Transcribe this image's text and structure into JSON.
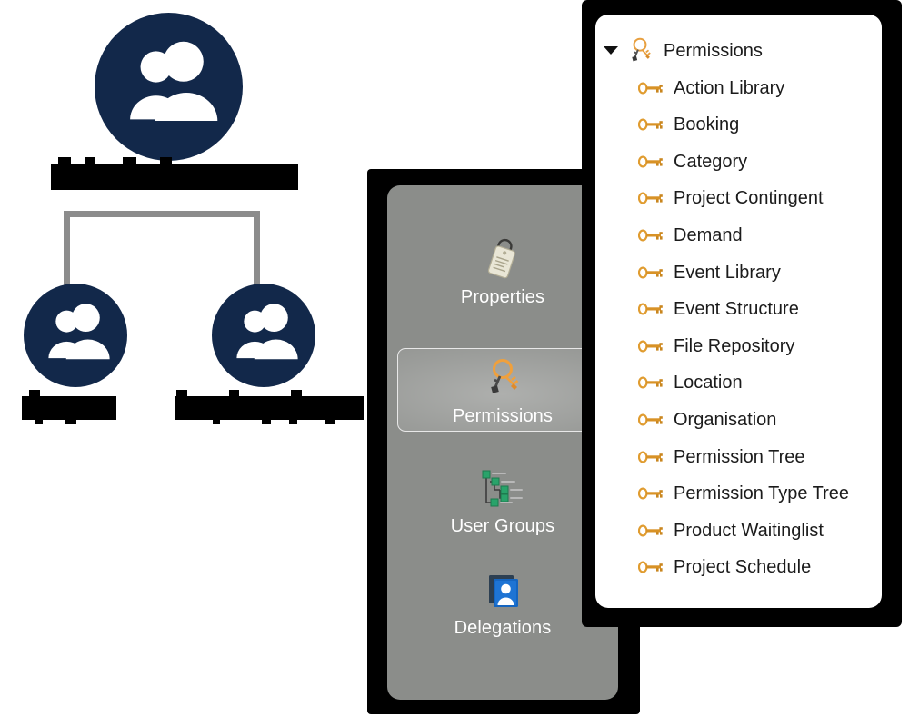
{
  "org_diagram": {
    "name": "organisation-hierarchy-diagram",
    "nodes": [
      {
        "id": "root",
        "icon": "users-group-icon",
        "label_redacted": true,
        "label": ""
      },
      {
        "id": "left",
        "icon": "users-group-icon",
        "label_redacted": true,
        "label": ""
      },
      {
        "id": "right",
        "icon": "users-group-icon",
        "label_redacted": true,
        "label": ""
      }
    ],
    "node_color": "#12284a",
    "connector_color": "#8c8c8c",
    "redaction_color": "#000000"
  },
  "sidebar": {
    "name": "module-navigation-sidebar",
    "background": "#8b8d8a",
    "selected": "Permissions",
    "items": [
      {
        "label": "Properties",
        "icon": "luggage-tag-icon",
        "selected": false
      },
      {
        "label": "Permissions",
        "icon": "keyring-keys-icon",
        "selected": true
      },
      {
        "label": "User Groups",
        "icon": "tree-nodes-icon",
        "selected": false
      },
      {
        "label": "Delegations",
        "icon": "person-card-icon",
        "selected": false
      }
    ]
  },
  "tree_panel": {
    "name": "permissions-tree-panel",
    "background": "#ffffff",
    "root": {
      "label": "Permissions",
      "icon": "keyring-keys-icon",
      "expanded": true,
      "twisty": "triangle-down-icon"
    },
    "children": [
      {
        "label": "Action Library",
        "icon": "key-icon"
      },
      {
        "label": "Booking",
        "icon": "key-icon"
      },
      {
        "label": "Category",
        "icon": "key-icon"
      },
      {
        "label": "Project Contingent",
        "icon": "key-icon"
      },
      {
        "label": "Demand",
        "icon": "key-icon"
      },
      {
        "label": "Event Library",
        "icon": "key-icon"
      },
      {
        "label": "Event Structure",
        "icon": "key-icon"
      },
      {
        "label": "File Repository",
        "icon": "key-icon"
      },
      {
        "label": "Location",
        "icon": "key-icon"
      },
      {
        "label": "Organisation",
        "icon": "key-icon"
      },
      {
        "label": "Permission Tree",
        "icon": "key-icon"
      },
      {
        "label": "Permission Type Tree",
        "icon": "key-icon"
      },
      {
        "label": "Product Waitinglist",
        "icon": "key-icon"
      },
      {
        "label": "Project Schedule",
        "icon": "key-icon"
      }
    ],
    "key_color": "#e49a21",
    "text_color": "#1b1b1b"
  }
}
